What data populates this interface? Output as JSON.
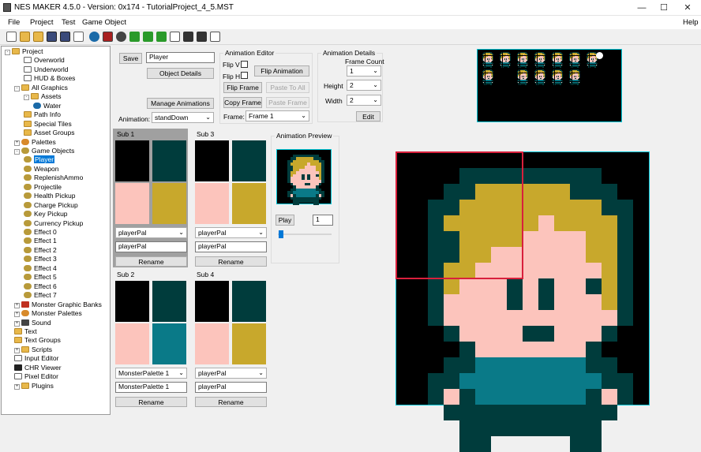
{
  "window": {
    "title": "NES MAKER 4.5.0 - Version: 0x174 - TutorialProject_4_5.MST",
    "help": "Help"
  },
  "menu": [
    "File",
    "Project",
    "Test",
    "Game Object"
  ],
  "tree": [
    {
      "label": "Project",
      "depth": 0,
      "exp": "-",
      "icon": "folder"
    },
    {
      "label": "Overworld",
      "depth": 2,
      "icon": "file"
    },
    {
      "label": "Underworld",
      "depth": 2,
      "icon": "file"
    },
    {
      "label": "HUD & Boxes",
      "depth": 2,
      "icon": "file"
    },
    {
      "label": "All Graphics",
      "depth": 1,
      "exp": "-",
      "icon": "folder"
    },
    {
      "label": "Assets",
      "depth": 2,
      "exp": "-",
      "icon": "folder"
    },
    {
      "label": "Water",
      "depth": 3,
      "icon": "globe"
    },
    {
      "label": "Path Info",
      "depth": 2,
      "icon": "folder"
    },
    {
      "label": "Special Tiles",
      "depth": 2,
      "icon": "folder"
    },
    {
      "label": "Asset Groups",
      "depth": 2,
      "icon": "folder"
    },
    {
      "label": "Palettes",
      "depth": 1,
      "exp": "+",
      "icon": "pal"
    },
    {
      "label": "Game Objects",
      "depth": 1,
      "exp": "-",
      "icon": "obj"
    },
    {
      "label": "Player",
      "depth": 2,
      "icon": "obj",
      "selected": true
    },
    {
      "label": "Weapon",
      "depth": 2,
      "icon": "obj"
    },
    {
      "label": "ReplenishAmmo",
      "depth": 2,
      "icon": "obj"
    },
    {
      "label": "Projectile",
      "depth": 2,
      "icon": "obj"
    },
    {
      "label": "Health Pickup",
      "depth": 2,
      "icon": "obj"
    },
    {
      "label": "Charge Pickup",
      "depth": 2,
      "icon": "obj"
    },
    {
      "label": "Key Pickup",
      "depth": 2,
      "icon": "obj"
    },
    {
      "label": "Currency Pickup",
      "depth": 2,
      "icon": "obj"
    },
    {
      "label": "Effect 0",
      "depth": 2,
      "icon": "obj"
    },
    {
      "label": "Effect 1",
      "depth": 2,
      "icon": "obj"
    },
    {
      "label": "Effect 2",
      "depth": 2,
      "icon": "obj"
    },
    {
      "label": "Effect 3",
      "depth": 2,
      "icon": "obj"
    },
    {
      "label": "Effect 4",
      "depth": 2,
      "icon": "obj"
    },
    {
      "label": "Effect 5",
      "depth": 2,
      "icon": "obj"
    },
    {
      "label": "Effect 6",
      "depth": 2,
      "icon": "obj"
    },
    {
      "label": "Effect 7",
      "depth": 2,
      "icon": "obj"
    },
    {
      "label": "Monster Graphic Banks",
      "depth": 1,
      "exp": "+",
      "icon": "monster"
    },
    {
      "label": "Monster Palettes",
      "depth": 1,
      "exp": "+",
      "icon": "pal"
    },
    {
      "label": "Sound",
      "depth": 1,
      "exp": "+",
      "icon": "sound"
    },
    {
      "label": "Text",
      "depth": 1,
      "icon": "folder"
    },
    {
      "label": "Text Groups",
      "depth": 1,
      "icon": "folder"
    },
    {
      "label": "Scripts",
      "depth": 1,
      "exp": "+",
      "icon": "folder"
    },
    {
      "label": "Input Editor",
      "depth": 1,
      "icon": "file"
    },
    {
      "label": "CHR Viewer",
      "depth": 1,
      "icon": "chr"
    },
    {
      "label": "Pixel Editor",
      "depth": 1,
      "icon": "file"
    },
    {
      "label": "Plugins",
      "depth": 1,
      "exp": "+",
      "icon": "folder"
    }
  ],
  "editor": {
    "save": "Save",
    "name_value": "Player",
    "object_details": "Object Details",
    "manage_animations": "Manage Animations",
    "animation_label": "Animation:",
    "animation_value": "standDown"
  },
  "anim_editor": {
    "title": "Animation Editor",
    "flip_v": "Flip V",
    "flip_h": "Flip H",
    "flip_animation": "Flip Animation",
    "flip_frame": "Flip Frame",
    "paste_to_all": "Paste To All",
    "copy_frame": "Copy Frame",
    "paste_frame": "Paste Frame",
    "frame_label": "Frame:",
    "frame_value": "Frame 1"
  },
  "anim_details": {
    "title": "Animation Details",
    "frame_count_label": "Frame Count",
    "frame_count": "1",
    "height_label": "Height",
    "height": "2",
    "width_label": "Width",
    "width": "2",
    "edit": "Edit"
  },
  "subs": [
    {
      "title": "Sub 1",
      "palette": "playerPal",
      "name": "playerPal",
      "rename": "Rename",
      "colors": [
        "#000000",
        "#003c3c",
        "#fcc4bc",
        "#c8a82c"
      ],
      "selected": true
    },
    {
      "title": "Sub 3",
      "palette": "playerPal",
      "name": "playerPal",
      "rename": "Rename",
      "colors": [
        "#000000",
        "#003c3c",
        "#fcc4bc",
        "#c8a82c"
      ]
    },
    {
      "title": "Sub 2",
      "palette": "MonsterPalette 1",
      "name": "MonsterPalette 1",
      "rename": "Rename",
      "colors": [
        "#000000",
        "#003c3c",
        "#fcc4bc",
        "#0a7a88"
      ]
    },
    {
      "title": "Sub 4",
      "palette": "playerPal",
      "name": "playerPal",
      "rename": "Rename",
      "colors": [
        "#000000",
        "#003c3c",
        "#fcc4bc",
        "#c8a82c"
      ]
    }
  ],
  "preview": {
    "title": "Animation Preview",
    "play": "Play",
    "speed": "1"
  },
  "colors": {
    "black": "#000000",
    "teal_dark": "#003c3c",
    "skin": "#fcc4bc",
    "gold": "#c8a82c",
    "teal": "#0a7a88",
    "cyan_border": "#00c8d8",
    "selection": "#d8203c"
  },
  "big_sprite": [
    "0000000000000000",
    "0000111111111000",
    "0001133333311100",
    "0011333333333110",
    "0013333332333310",
    "0011333322223310",
    "0011332222223310",
    "0013322222222310",
    "0013222121221310",
    "0012222121222310",
    "0012222222222210",
    "0001222211222100",
    "0000122222221000",
    "0001144444441100",
    "0011444444444110",
    "0012144444441210",
    "0001111111111100",
    "0000111111111000",
    "0000110000011000"
  ]
}
